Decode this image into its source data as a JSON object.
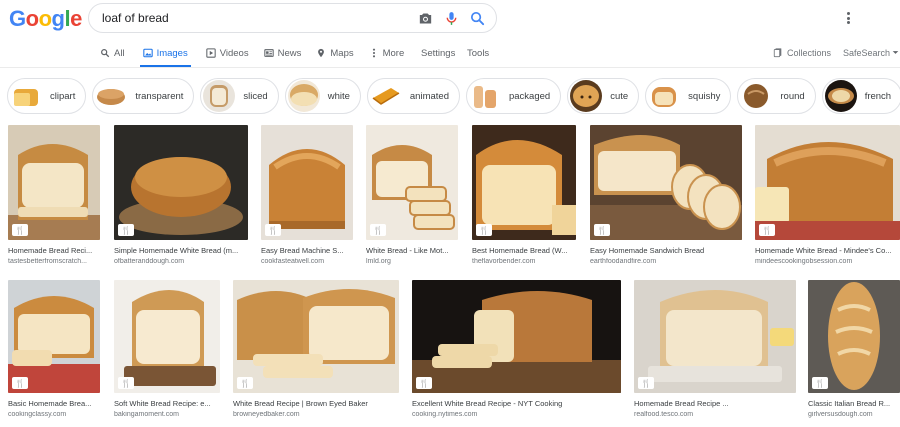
{
  "logo": {
    "letters": [
      "G",
      "o",
      "o",
      "g",
      "l",
      "e"
    ]
  },
  "search": {
    "query": "loaf of bread"
  },
  "tabs": [
    {
      "label": "All",
      "icon": "search-icon"
    },
    {
      "label": "Images",
      "icon": "image-icon",
      "active": true
    },
    {
      "label": "Videos",
      "icon": "play-icon"
    },
    {
      "label": "News",
      "icon": "news-icon"
    },
    {
      "label": "Maps",
      "icon": "map-pin-icon"
    },
    {
      "label": "More",
      "icon": "more-vert-icon"
    }
  ],
  "settings_label": "Settings",
  "tools_label": "Tools",
  "collections_label": "Collections",
  "safesearch_label": "SafeSearch",
  "chips": [
    {
      "label": "clipart"
    },
    {
      "label": "transparent"
    },
    {
      "label": "sliced"
    },
    {
      "label": "white"
    },
    {
      "label": "animated"
    },
    {
      "label": "packaged"
    },
    {
      "label": "cute"
    },
    {
      "label": "squishy"
    },
    {
      "label": "round"
    },
    {
      "label": "french"
    }
  ],
  "results_row1": [
    {
      "title": "Homemade Bread Reci...",
      "source": "tastesbetterfromscratch..."
    },
    {
      "title": "Simple Homemade White Bread (m...",
      "source": "ofbatteranddough.com"
    },
    {
      "title": "Easy Bread Machine S...",
      "source": "cookfasteatwell.com"
    },
    {
      "title": "White Bread - Like Mot...",
      "source": "lmld.org"
    },
    {
      "title": "Best Homemade Bread (W...",
      "source": "theflavorbender.com"
    },
    {
      "title": "Easy Homemade Sandwich Bread",
      "source": "earthfoodandfire.com"
    },
    {
      "title": "Homemade White Bread - Mindee's Co...",
      "source": "mindeescookingobsession.com"
    }
  ],
  "results_row2": [
    {
      "title": "Basic Homemade Brea...",
      "source": "cookingclassy.com"
    },
    {
      "title": "Soft White Bread Recipe: e...",
      "source": "bakingamoment.com"
    },
    {
      "title": "White Bread Recipe | Brown Eyed Baker",
      "source": "browneyedbaker.com"
    },
    {
      "title": "Excellent White Bread Recipe - NYT Cooking",
      "source": "cooking.nytimes.com"
    },
    {
      "title": "Homemade Bread Recipe ...",
      "source": "realfood.tesco.com"
    },
    {
      "title": "Classic Italian Bread R...",
      "source": "girlversusdough.com"
    }
  ],
  "badge_icon": "recipe-utensils-icon",
  "colors": {
    "accent": "#1a73e8",
    "crust": "#c98a3c",
    "crumb": "#f3e4c2"
  }
}
